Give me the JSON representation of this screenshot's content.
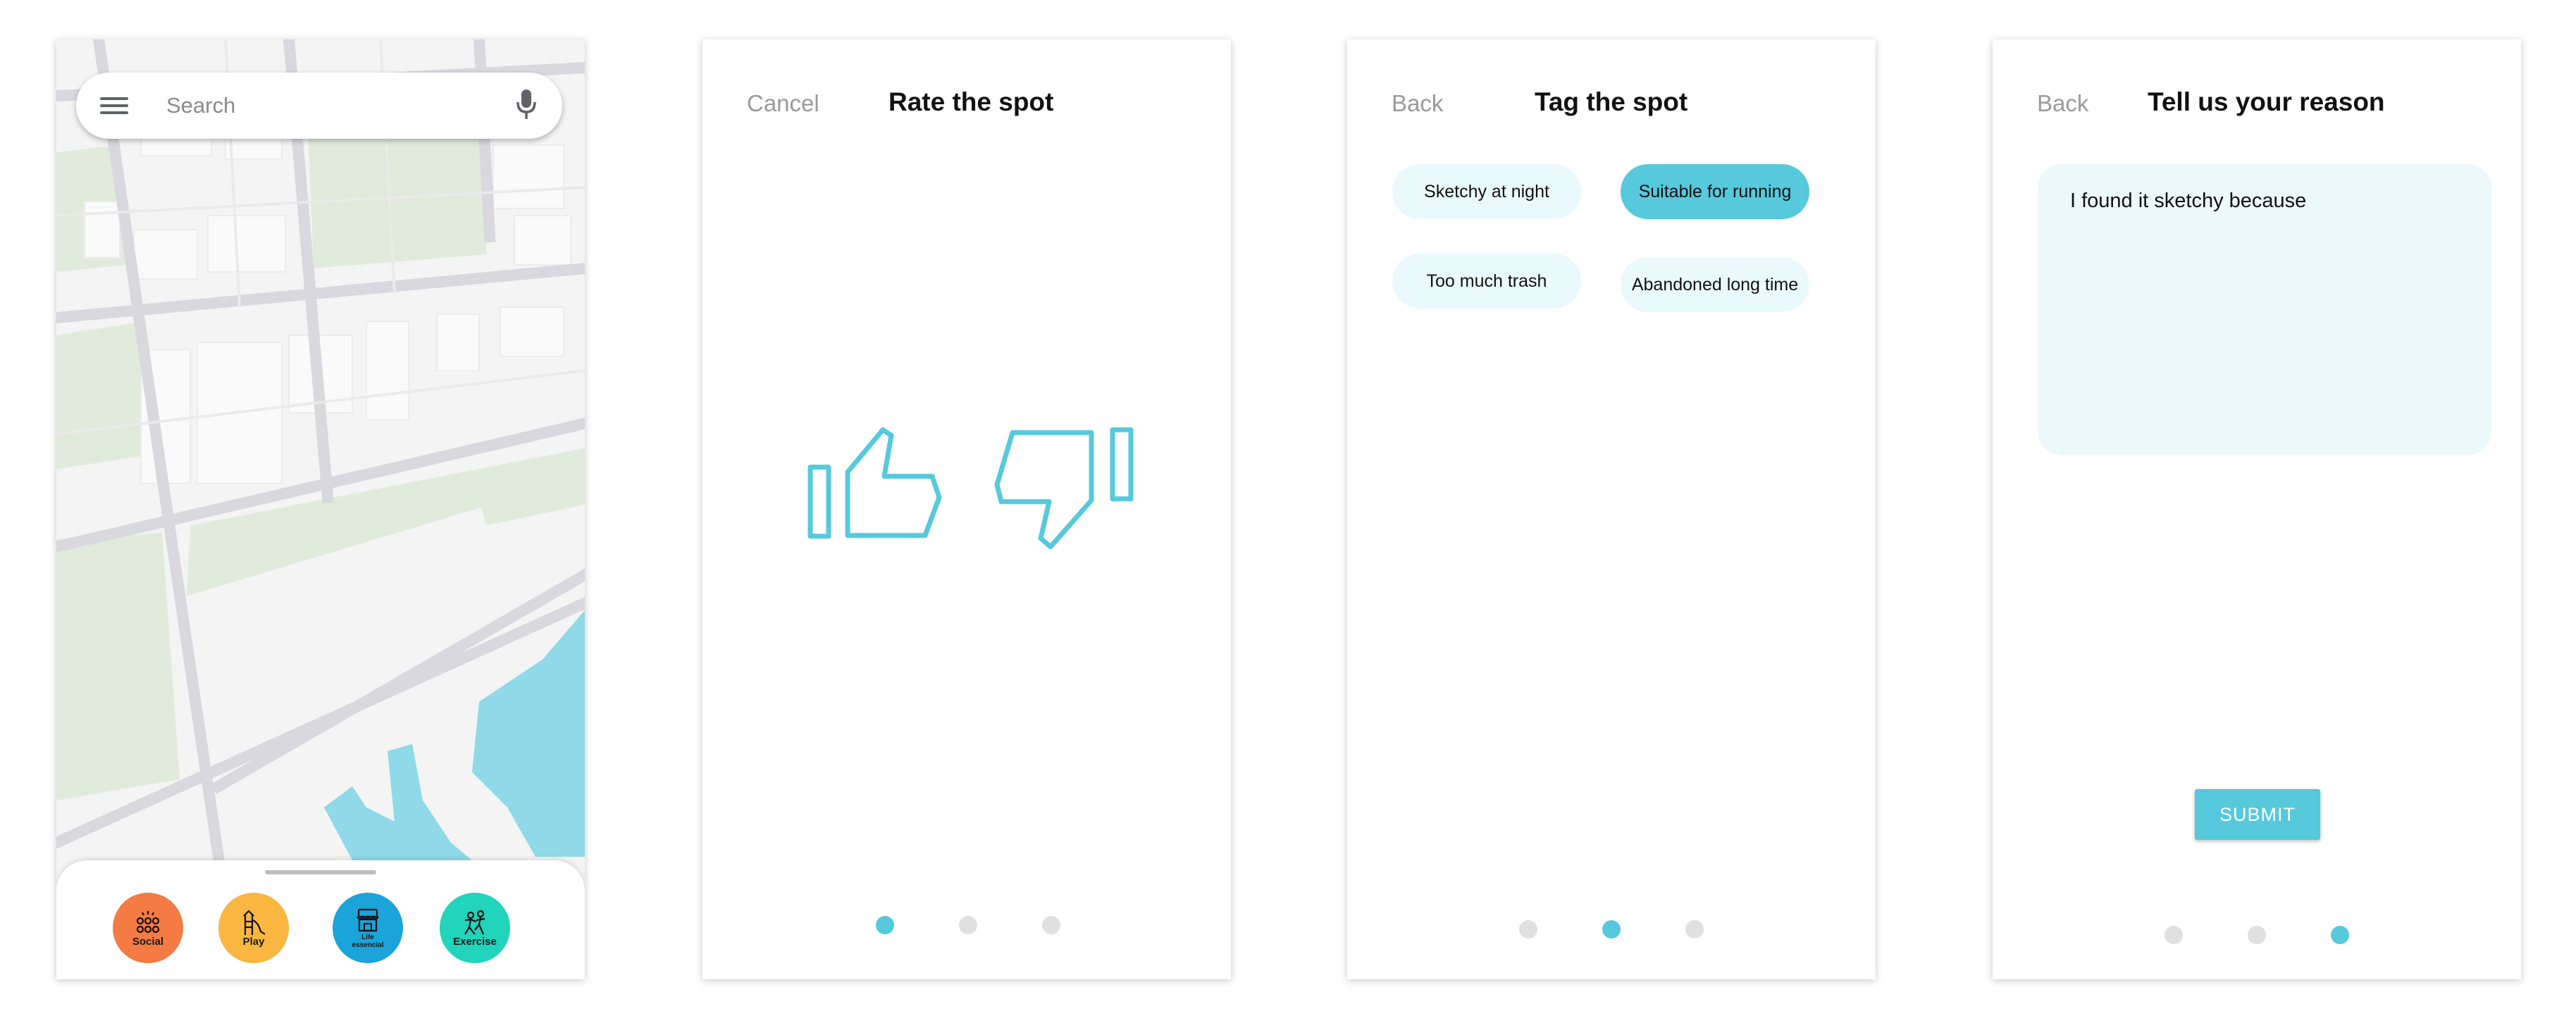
{
  "map_screen": {
    "search": {
      "placeholder": "Search"
    },
    "categories": [
      {
        "label": "Social",
        "color": "#f47b43",
        "icon": "people-group-icon"
      },
      {
        "label": "Play",
        "color": "#f9b741",
        "icon": "playground-slide-icon"
      },
      {
        "label": "Life essencial",
        "label_line1": "Life",
        "label_line2": "essencial",
        "color": "#1ba4d9",
        "icon": "storefront-icon"
      },
      {
        "label": "Exercise",
        "color": "#21d4bb",
        "icon": "exercise-people-icon"
      }
    ],
    "map_colors": {
      "land": "#f4f4f4",
      "road": "#d8d8de",
      "park": "#e1ebdc",
      "water": "#8fd9e8"
    }
  },
  "rate_screen": {
    "cancel_label": "Cancel",
    "title": "Rate the spot",
    "thumbs_up_icon": "thumbs-up-icon",
    "thumbs_down_icon": "thumbs-down-icon",
    "page_index": 1,
    "page_count": 3
  },
  "tag_screen": {
    "back_label": "Back",
    "title": "Tag the spot",
    "tags": [
      {
        "label": "Sketchy at night",
        "selected": false
      },
      {
        "label": "Suitable for running",
        "selected": true
      },
      {
        "label": "Too much trash",
        "selected": false
      },
      {
        "label": "Abandoned long time",
        "selected": false
      }
    ],
    "page_index": 2,
    "page_count": 3
  },
  "reason_screen": {
    "back_label": "Back",
    "title": "Tell us your reason",
    "reason_text": "I found it sketchy because",
    "submit_label": "SUBMIT",
    "page_index": 3,
    "page_count": 3
  },
  "accent_color": "#56c9dc"
}
